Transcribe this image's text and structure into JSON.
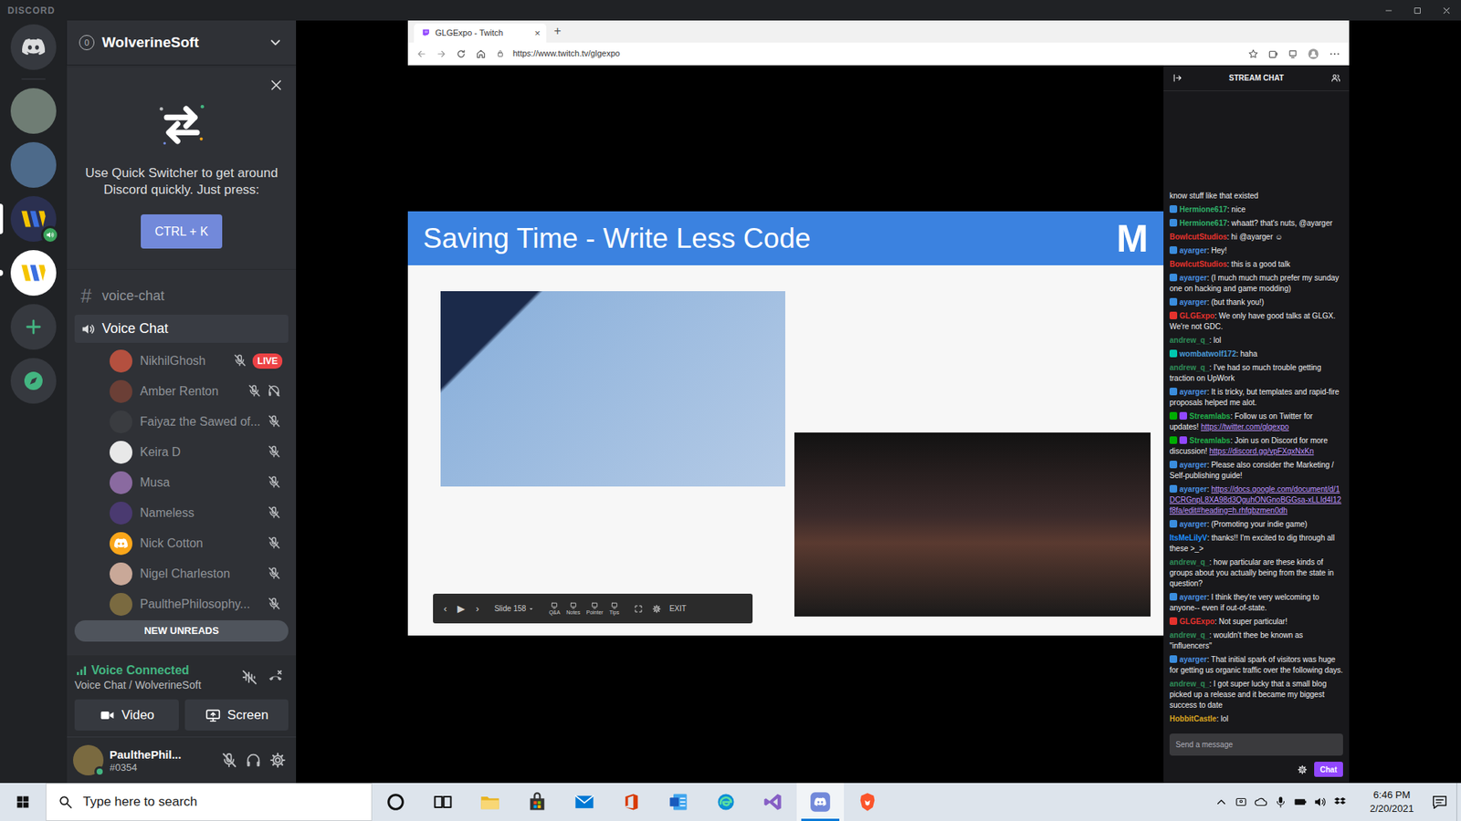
{
  "window": {
    "title": "DISCORD"
  },
  "servers": [
    {
      "kind": "home",
      "color": "#36393f",
      "selected": false,
      "unread": false,
      "voice": false
    },
    {
      "kind": "photo",
      "color": "#6f7d74",
      "selected": false,
      "unread": false,
      "voice": false
    },
    {
      "kind": "photo",
      "color": "#4d6a8a",
      "selected": false,
      "unread": false,
      "voice": false
    },
    {
      "kind": "wolverine",
      "color": "#2b3050",
      "selected": true,
      "unread": false,
      "voice": true
    },
    {
      "kind": "wolverine",
      "color": "#ffffff",
      "selected": false,
      "unread": true,
      "voice": false
    },
    {
      "kind": "add",
      "color": "#36393f",
      "selected": false,
      "unread": false,
      "voice": false
    },
    {
      "kind": "explore",
      "color": "#36393f",
      "selected": false,
      "unread": false,
      "voice": false
    }
  ],
  "server": {
    "name": "WolverineSoft",
    "boosts": "0"
  },
  "quick_switcher": {
    "text": "Use Quick Switcher to get around Discord quickly. Just press:",
    "shortcut": "CTRL + K"
  },
  "channels": [
    {
      "kind": "text",
      "icon": "#",
      "name": "voice-chat",
      "selected": false
    },
    {
      "kind": "voice",
      "name": "Voice Chat",
      "selected": true
    }
  ],
  "members": [
    {
      "name": "NikhilGhosh",
      "kind": "photo",
      "color": "#b4503f",
      "muted": true,
      "deafened": false,
      "live": true,
      "badge": "LIVE"
    },
    {
      "name": "Amber Renton",
      "kind": "photo",
      "color": "#6b3f36",
      "muted": true,
      "deafened": true,
      "live": false
    },
    {
      "name": "Faiyaz the Sawed of...",
      "kind": "photo",
      "color": "#3a3c40",
      "muted": true,
      "deafened": false,
      "live": false
    },
    {
      "name": "Keira D",
      "kind": "photo",
      "color": "#e8e8e8",
      "muted": true,
      "deafened": false,
      "live": false
    },
    {
      "name": "Musa",
      "kind": "photo",
      "color": "#8a6aa0",
      "muted": true,
      "deafened": false,
      "live": false
    },
    {
      "name": "Nameless",
      "kind": "photo",
      "color": "#4a3a70",
      "muted": true,
      "deafened": false,
      "live": false
    },
    {
      "name": "Nick Cotton",
      "kind": "default",
      "color": "#faa61a",
      "muted": true,
      "deafened": false,
      "live": false
    },
    {
      "name": "Nigel Charleston",
      "kind": "photo",
      "color": "#c9a898",
      "muted": true,
      "deafened": false,
      "live": false
    },
    {
      "name": "PaulthePhilosophy...",
      "kind": "photo",
      "color": "#7a6a40",
      "muted": true,
      "deafened": false,
      "live": false
    }
  ],
  "new_unreads": "NEW UNREADS",
  "voice": {
    "status": "Voice Connected",
    "location": "Voice Chat / WolverineSoft",
    "buttons": [
      {
        "kind": "video",
        "label": "Video"
      },
      {
        "kind": "screen",
        "label": "Screen"
      }
    ]
  },
  "user": {
    "name": "PaulthePhil...",
    "tag": "#0354",
    "online": true,
    "muted": true,
    "deafened": false
  },
  "browser": {
    "tab": "GLGExpo - Twitch",
    "tab_close": "×",
    "new_tab": "+",
    "url": "https://www.twitch.tv/glgexpo"
  },
  "slide": {
    "title": "Saving Time - Write Less Code",
    "logo": "M",
    "nav": [
      "‹",
      "▶",
      "›"
    ],
    "counter": "Slide 158",
    "tools": [
      "Q&A",
      "Notes",
      "Pointer",
      "Tips"
    ],
    "exit": "EXIT"
  },
  "chat": {
    "title": "STREAM CHAT",
    "messages": [
      {
        "badges": [],
        "text": "know stuff like that existed"
      },
      {
        "badges": [
          {
            "color": "#3a8dde"
          }
        ],
        "name": "Hermione617",
        "color": "#2fb06a",
        "text": ": nice"
      },
      {
        "badges": [
          {
            "color": "#3a8dde"
          }
        ],
        "name": "Hermione617",
        "color": "#2fb06a",
        "text": ": whaatt? that's nuts, @ayarger"
      },
      {
        "badges": [],
        "name": "BowlcutStudios",
        "color": "#e5322d",
        "text": ": hi @ayarger ☺"
      },
      {
        "badges": [
          {
            "color": "#3a8dde"
          }
        ],
        "name": "ayarger",
        "color": "#4a90e2",
        "text": ": Hey!"
      },
      {
        "badges": [],
        "name": "BowlcutStudios",
        "color": "#e5322d",
        "text": ": this is a good talk"
      },
      {
        "badges": [
          {
            "color": "#3a8dde"
          }
        ],
        "name": "ayarger",
        "color": "#4a90e2",
        "text": ": (I much much much prefer my sunday one on hacking and game modding)"
      },
      {
        "badges": [
          {
            "color": "#3a8dde"
          }
        ],
        "name": "ayarger",
        "color": "#4a90e2",
        "text": ": (but thank you!)"
      },
      {
        "badges": [
          {
            "color": "#e5322d"
          }
        ],
        "name": "GLGExpo",
        "color": "#e5322d",
        "text": ": We only have good talks at GLGX. We're not GDC."
      },
      {
        "badges": [],
        "name": "andrew_q_",
        "color": "#2e8b57",
        "text": ": lol"
      },
      {
        "badges": [
          {
            "color": "#00c8af"
          }
        ],
        "name": "wombatwolf172",
        "color": "#4a9ad8",
        "text": ": haha"
      },
      {
        "badges": [],
        "name": "andrew_q_",
        "color": "#2e8b57",
        "text": ": I've had so much trouble getting traction on UpWork"
      },
      {
        "badges": [
          {
            "color": "#3a8dde"
          }
        ],
        "name": "ayarger",
        "color": "#4a90e2",
        "text": ": It is tricky, but templates and rapid-fire proposals helped me alot."
      },
      {
        "badges": [
          {
            "color": "#00ad03"
          },
          {
            "color": "#9147ff"
          }
        ],
        "name": "Streamlabs",
        "color": "#20b24a",
        "text": ": Follow us on Twitter for updates! ",
        "link": "https://twitter.com/glgexpo"
      },
      {
        "badges": [
          {
            "color": "#00ad03"
          },
          {
            "color": "#9147ff"
          }
        ],
        "name": "Streamlabs",
        "color": "#20b24a",
        "text": ": Join us on Discord for more discussion! ",
        "link": "https://discord.gg/vpFXgxNxKn"
      },
      {
        "badges": [
          {
            "color": "#3a8dde"
          }
        ],
        "name": "ayarger",
        "color": "#4a90e2",
        "text": ": Please also consider the Marketing / Self-publishing guide!"
      },
      {
        "badges": [
          {
            "color": "#3a8dde"
          }
        ],
        "name": "ayarger",
        "color": "#4a90e2",
        "text": ": ",
        "link": "https://docs.google.com/document/d/1DCRGnpL8XA98d3QguhONGnoBGGsa-xLLId4I12f8fa/edit#heading=h.rhfgbzmen0dh"
      },
      {
        "badges": [
          {
            "color": "#3a8dde"
          }
        ],
        "name": "ayarger",
        "color": "#4a90e2",
        "text": ": (Promoting your indie game)"
      },
      {
        "badges": [],
        "name": "ItsMeLilyV",
        "color": "#1e90ff",
        "text": ": thanks!! I'm excited to dig through all these >_>"
      },
      {
        "badges": [],
        "name": "andrew_q_",
        "color": "#2e8b57",
        "text": ": how particular are these kinds of groups about you actually being from the state in question?"
      },
      {
        "badges": [
          {
            "color": "#3a8dde"
          }
        ],
        "name": "ayarger",
        "color": "#4a90e2",
        "text": ": I think they're very welcoming to anyone-- even if out-of-state."
      },
      {
        "badges": [
          {
            "color": "#e5322d"
          }
        ],
        "name": "GLGExpo",
        "color": "#e5322d",
        "text": ": Not super particular!"
      },
      {
        "badges": [],
        "name": "andrew_q_",
        "color": "#2e8b57",
        "text": ": wouldn't thee be known as \"influencers\""
      },
      {
        "badges": [
          {
            "color": "#3a8dde"
          }
        ],
        "name": "ayarger",
        "color": "#4a90e2",
        "text": ": That initial spark of visitors was huge for getting us organic traffic over the following days."
      },
      {
        "badges": [],
        "name": "andrew_q_",
        "color": "#2e8b57",
        "text": ": I got super lucky that a small blog picked up a release and it became my biggest success to date"
      },
      {
        "badges": [],
        "name": "HobbitCastle",
        "color": "#daa520",
        "text": ": lol"
      }
    ],
    "placeholder": "Send a message",
    "button": "Chat"
  },
  "taskbar": {
    "search": "Type here to search",
    "apps": [
      {
        "kind": "cortana",
        "active": false
      },
      {
        "kind": "taskview",
        "active": false
      },
      {
        "kind": "explorer",
        "active": false
      },
      {
        "kind": "store",
        "active": false
      },
      {
        "kind": "mail",
        "active": false
      },
      {
        "kind": "office",
        "active": false
      },
      {
        "kind": "word",
        "active": false
      },
      {
        "kind": "edge",
        "active": false
      },
      {
        "kind": "vs",
        "active": false
      },
      {
        "kind": "discord",
        "active": true
      },
      {
        "kind": "brave",
        "active": false
      }
    ],
    "time": "6:46 PM",
    "date": "2/20/2021"
  }
}
